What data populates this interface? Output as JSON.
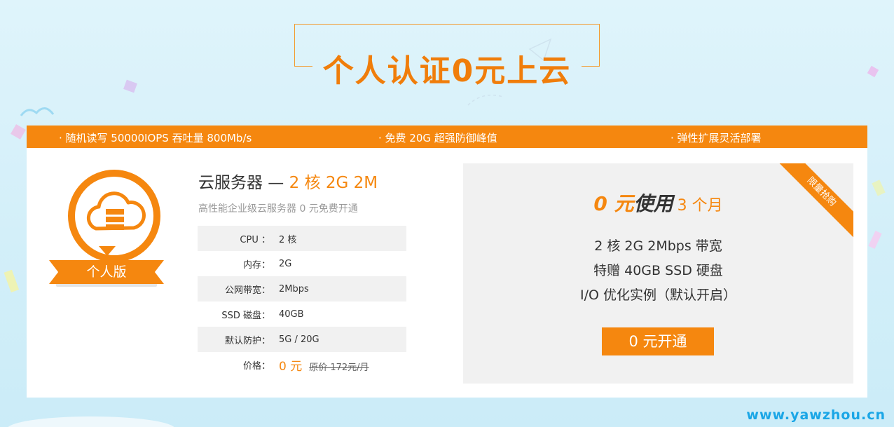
{
  "header": {
    "title": "个人认证0元上云"
  },
  "features": [
    "· 随机读写 50000IOPS 吞吐量 800Mb/s",
    "· 免费 20G 超强防御峰值",
    "· 弹性扩展灵活部署"
  ],
  "badge": {
    "label": "个人版",
    "icon": "cloud-server-icon"
  },
  "product": {
    "title_prefix": "云服务器 — ",
    "title_highlight": "2 核 2G 2M",
    "subtitle": "高性能企业级云服务器 0 元免费开通",
    "specs": [
      {
        "label": "CPU ：",
        "value": "2 核"
      },
      {
        "label": "内存：",
        "value": "2G"
      },
      {
        "label": "公网带宽：",
        "value": "2Mbps"
      },
      {
        "label": "SSD 磁盘：",
        "value": "40GB"
      },
      {
        "label": "默认防护：",
        "value": "5G / 20G"
      }
    ],
    "price": {
      "label": "价格：",
      "value": "0 元",
      "original": "原价 172元/月"
    }
  },
  "offer": {
    "corner_tag": "限量抢购",
    "zero": "0 元",
    "use": "使用",
    "months": "3 个月",
    "lines": [
      "2 核 2G 2Mbps 带宽",
      "特赠 40GB SSD 硬盘",
      "I/O 优化实例（默认开启）"
    ],
    "button": "0 元开通"
  },
  "watermark": "www.yawzhou.cn",
  "colors": {
    "accent": "#f5870f",
    "title": "#f07d0a",
    "background": "#d3eff9"
  }
}
